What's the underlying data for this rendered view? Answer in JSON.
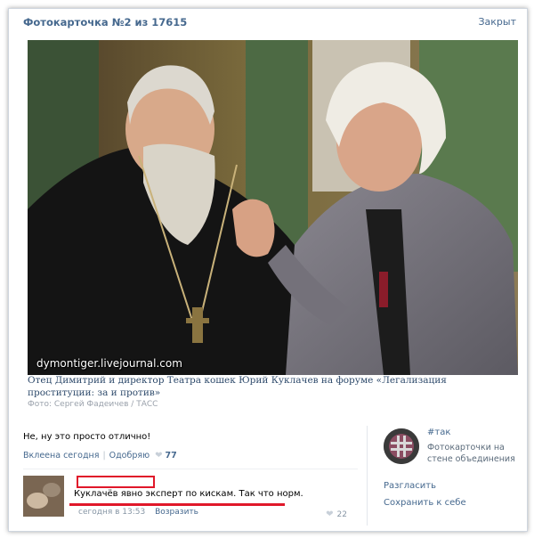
{
  "header": {
    "title": "Фотокарточка №2 из 17615",
    "close_label": "Закрыт"
  },
  "photo": {
    "watermark": "dymontiger.livejournal.com",
    "caption": "Отец Димитрий и директор Театра кошек Юрий Куклачев на форуме «Легализация проституции: за и против»",
    "credit": "Фото: Сергей Фадеичев / ТАСС"
  },
  "post": {
    "text": "Не, ну это просто отлично!",
    "posted": "Вклеена сегодня",
    "approve_label": "Одобряю",
    "likes": "77"
  },
  "comment": {
    "text": "Куклачёв явно эксперт по кискам. Так что норм.",
    "time": "сегодня в 13:53",
    "reply_label": "Возразить",
    "likes": "22"
  },
  "sidebar": {
    "tag": "#так",
    "description": "Фотокарточки на стене объединения",
    "actions": [
      "Разгласить",
      "Сохранить к себе"
    ]
  },
  "colors": {
    "link": "#45688e",
    "highlight": "#e0182a"
  }
}
